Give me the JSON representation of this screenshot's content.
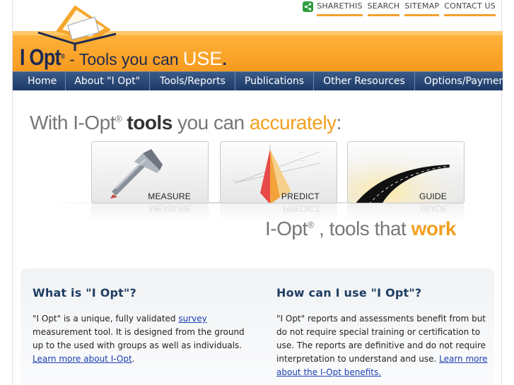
{
  "header": {
    "top_links": [
      "SHARETHIS",
      "SEARCH",
      "SITEMAP",
      "CONTACT US"
    ],
    "logo_text": "I Opt",
    "logo_reg": "®",
    "tagline_prefix": "- Tools you can ",
    "tagline_use": "USE",
    "tagline_dot": "."
  },
  "nav": [
    "Home",
    "About \"I Opt\"",
    "Tools/Reports",
    "Publications",
    "Other Resources",
    "Options/Payment"
  ],
  "hero": {
    "title_a": "With I-Opt",
    "reg": "®",
    "title_tools": " tools",
    "title_b": " you can ",
    "title_acc": "accurately",
    "title_colon": ":",
    "cards": [
      "MEASURE",
      "PREDICT",
      "GUIDE"
    ],
    "sub_a": "I-Opt",
    "sub_reg": "®",
    "sub_b": " , tools that ",
    "sub_work": "work"
  },
  "info": {
    "left": {
      "heading": "What is \"I Opt\"?",
      "text_a": "\"I Opt\" is a unique, fully validated ",
      "link_survey": "survey",
      "text_b": " measurement tool. It is designed from the ground up to the used with groups as well as individuals. ",
      "link_more": "Learn more about I-Opt",
      "text_c": "."
    },
    "right": {
      "heading": "How can I use \"I Opt\"?",
      "text_a": "\"I Opt\" reports and assessments benefit from but do not require special training or certification to use. The reports are definitive and do not require interpretation to understand and use. ",
      "link_more": "Learn more about the I-Opt benefits."
    }
  },
  "colors": {
    "accent_orange": "#f79a1e",
    "nav_blue": "#1d3a66",
    "heading_blue": "#1f3d63",
    "link_blue": "#1a3fb0"
  }
}
